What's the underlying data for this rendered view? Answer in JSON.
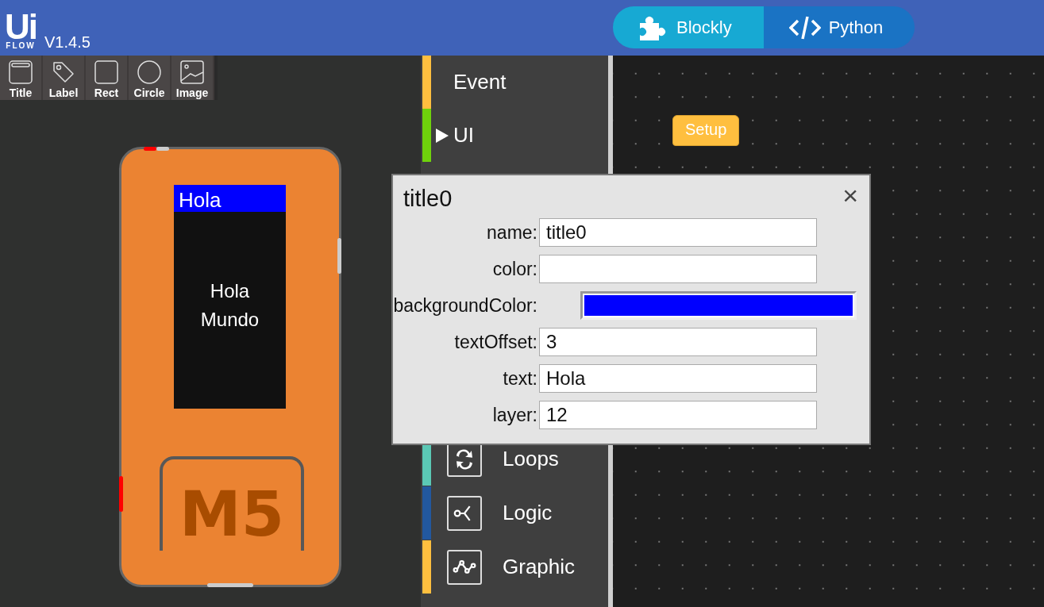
{
  "header": {
    "logo_top": "Ui",
    "logo_bottom": "FLOW",
    "version": "V1.4.5",
    "modes": [
      {
        "label": "Blockly",
        "selected": true
      },
      {
        "label": "Python",
        "selected": false
      }
    ]
  },
  "tools": [
    {
      "label": "Title"
    },
    {
      "label": "Label"
    },
    {
      "label": "Rect"
    },
    {
      "label": "Circle"
    },
    {
      "label": "Image"
    }
  ],
  "device": {
    "title": "Hola",
    "label": "Hola Mundo",
    "logo": "M5"
  },
  "categories": [
    {
      "name": "Event",
      "kind": "plain",
      "color": "#ffbf3f"
    },
    {
      "name": "UI",
      "kind": "expandable",
      "color": "#6fd20c"
    },
    {
      "name": "Loops",
      "kind": "icon",
      "color": "#5bc8b5"
    },
    {
      "name": "Logic",
      "kind": "icon",
      "color": "#22589f"
    },
    {
      "name": "Graphic",
      "kind": "icon",
      "color": "#ffbf3f"
    }
  ],
  "workspace": {
    "block": "Setup"
  },
  "dialog": {
    "title": "title0",
    "close": "×",
    "fields": [
      {
        "label": "name:",
        "kind": "text",
        "value": "title0"
      },
      {
        "label": "color:",
        "kind": "text"
      },
      {
        "label": "backgroundColor:",
        "kind": "color",
        "color": "#0000ff"
      },
      {
        "label": "textOffset:",
        "kind": "text",
        "value": "3"
      },
      {
        "label": "text:",
        "kind": "text",
        "value": "Hola"
      },
      {
        "label": "layer:",
        "kind": "text",
        "value": "12"
      }
    ]
  }
}
